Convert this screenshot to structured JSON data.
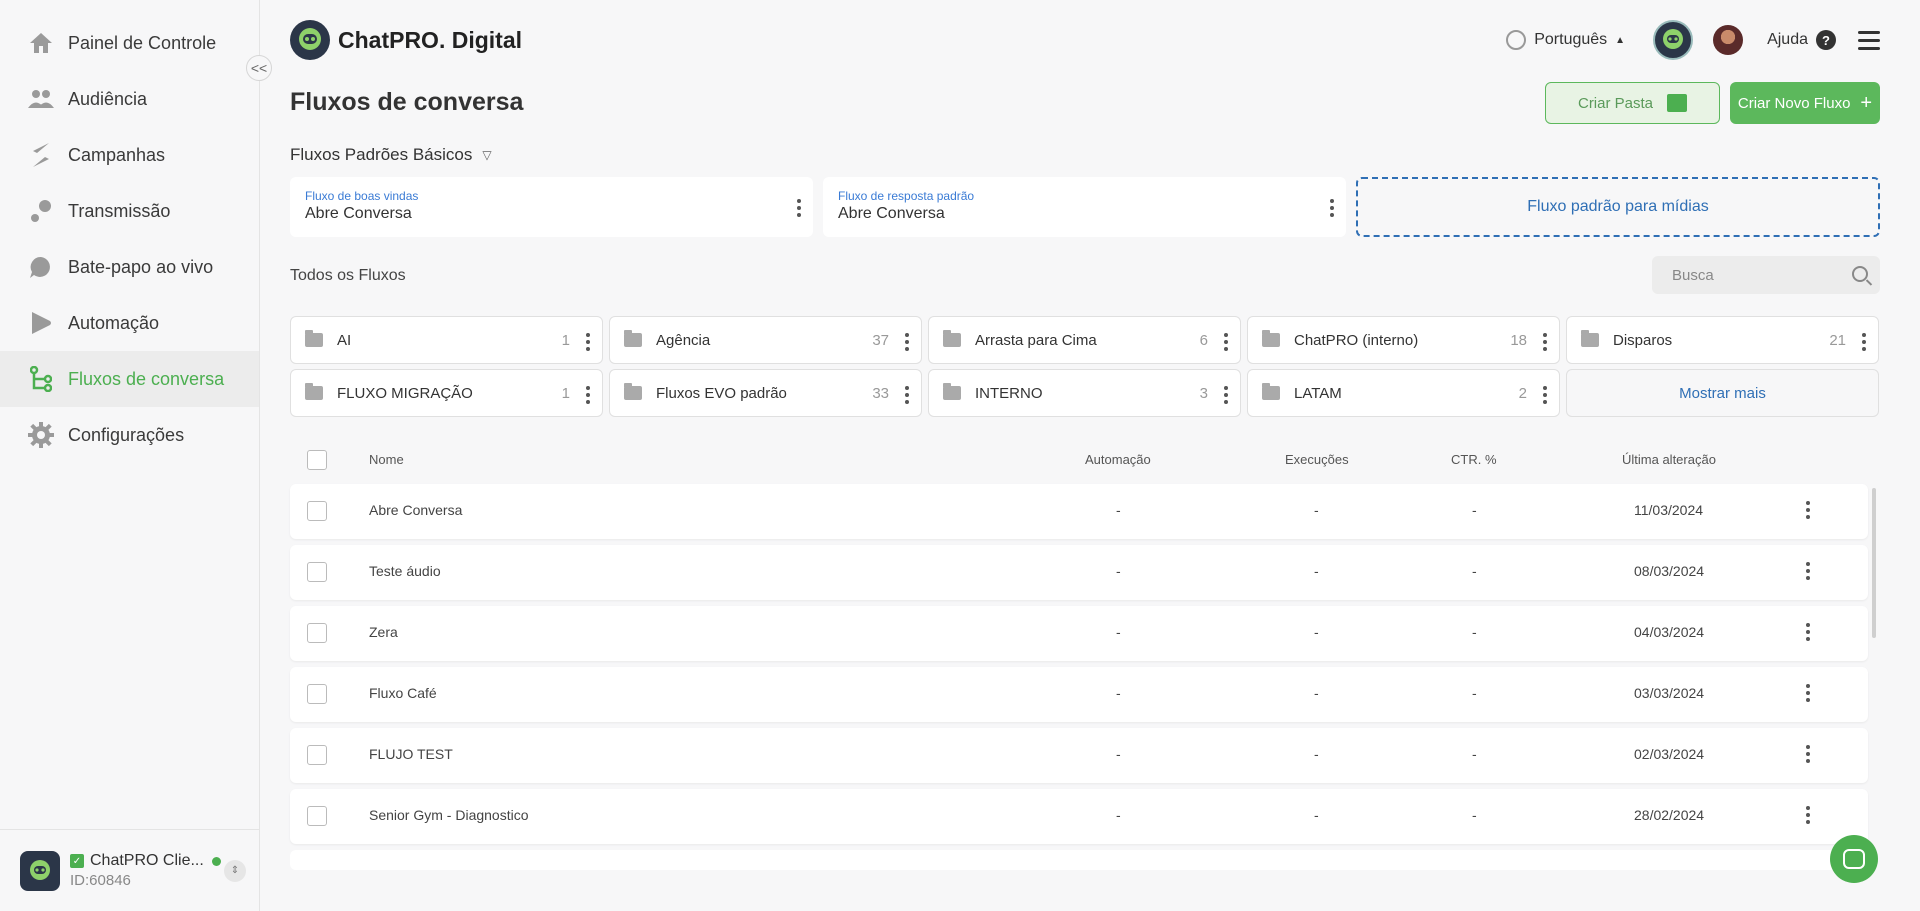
{
  "sidebar": {
    "items": [
      {
        "label": "Painel de Controle",
        "icon": "home-icon"
      },
      {
        "label": "Audiência",
        "icon": "people-icon"
      },
      {
        "label": "Campanhas",
        "icon": "campaign-icon"
      },
      {
        "label": "Transmissão",
        "icon": "broadcast-icon"
      },
      {
        "label": "Bate-papo ao vivo",
        "icon": "chat-icon"
      },
      {
        "label": "Automação",
        "icon": "automation-icon"
      },
      {
        "label": "Fluxos de conversa",
        "icon": "flow-icon"
      },
      {
        "label": "Configurações",
        "icon": "gear-icon"
      }
    ],
    "active_index": 6,
    "collapse_symbol": "<<",
    "account": {
      "name": "ChatPRO Clie...",
      "id": "ID:60846"
    }
  },
  "header": {
    "brand": "ChatPRO. Digital",
    "language": "Português",
    "help": "Ajuda"
  },
  "page": {
    "title": "Fluxos de conversa",
    "create_folder_label": "Criar Pasta",
    "create_flow_label": "Criar Novo Fluxo",
    "defaults_title": "Fluxos Padrões Básicos",
    "welcome_label": "Fluxo de boas vindas",
    "welcome_value": "Abre Conversa",
    "reply_label": "Fluxo de resposta padrão",
    "reply_value": "Abre Conversa",
    "media_label": "Fluxo padrão para mídias",
    "all_flows_title": "Todos os Fluxos",
    "search_placeholder": "Busca",
    "show_more": "Mostrar mais"
  },
  "folders": [
    {
      "name": "AI",
      "count": "1"
    },
    {
      "name": "Agência",
      "count": "37"
    },
    {
      "name": "Arrasta para Cima",
      "count": "6"
    },
    {
      "name": "ChatPRO (interno)",
      "count": "18"
    },
    {
      "name": "Disparos",
      "count": "21"
    },
    {
      "name": "FLUXO MIGRAÇÃO",
      "count": "1"
    },
    {
      "name": "Fluxos EVO padrão",
      "count": "33"
    },
    {
      "name": "INTERNO",
      "count": "3"
    },
    {
      "name": "LATAM",
      "count": "2"
    }
  ],
  "table": {
    "columns": {
      "name": "Nome",
      "automation": "Automação",
      "executions": "Execuções",
      "ctr": "CTR. %",
      "last_change": "Última alteração"
    },
    "rows": [
      {
        "name": "Abre Conversa",
        "automation": "-",
        "executions": "-",
        "ctr": "-",
        "date": "11/03/2024"
      },
      {
        "name": "Teste áudio",
        "automation": "-",
        "executions": "-",
        "ctr": "-",
        "date": "08/03/2024"
      },
      {
        "name": "Zera",
        "automation": "-",
        "executions": "-",
        "ctr": "-",
        "date": "04/03/2024"
      },
      {
        "name": "Fluxo Café",
        "automation": "-",
        "executions": "-",
        "ctr": "-",
        "date": "03/03/2024"
      },
      {
        "name": "FLUJO TEST",
        "automation": "-",
        "executions": "-",
        "ctr": "-",
        "date": "02/03/2024"
      },
      {
        "name": "Senior Gym - Diagnostico",
        "automation": "-",
        "executions": "-",
        "ctr": "-",
        "date": "28/02/2024"
      }
    ]
  },
  "colors": {
    "accent": "#4caf50",
    "link": "#2f6fb5"
  }
}
